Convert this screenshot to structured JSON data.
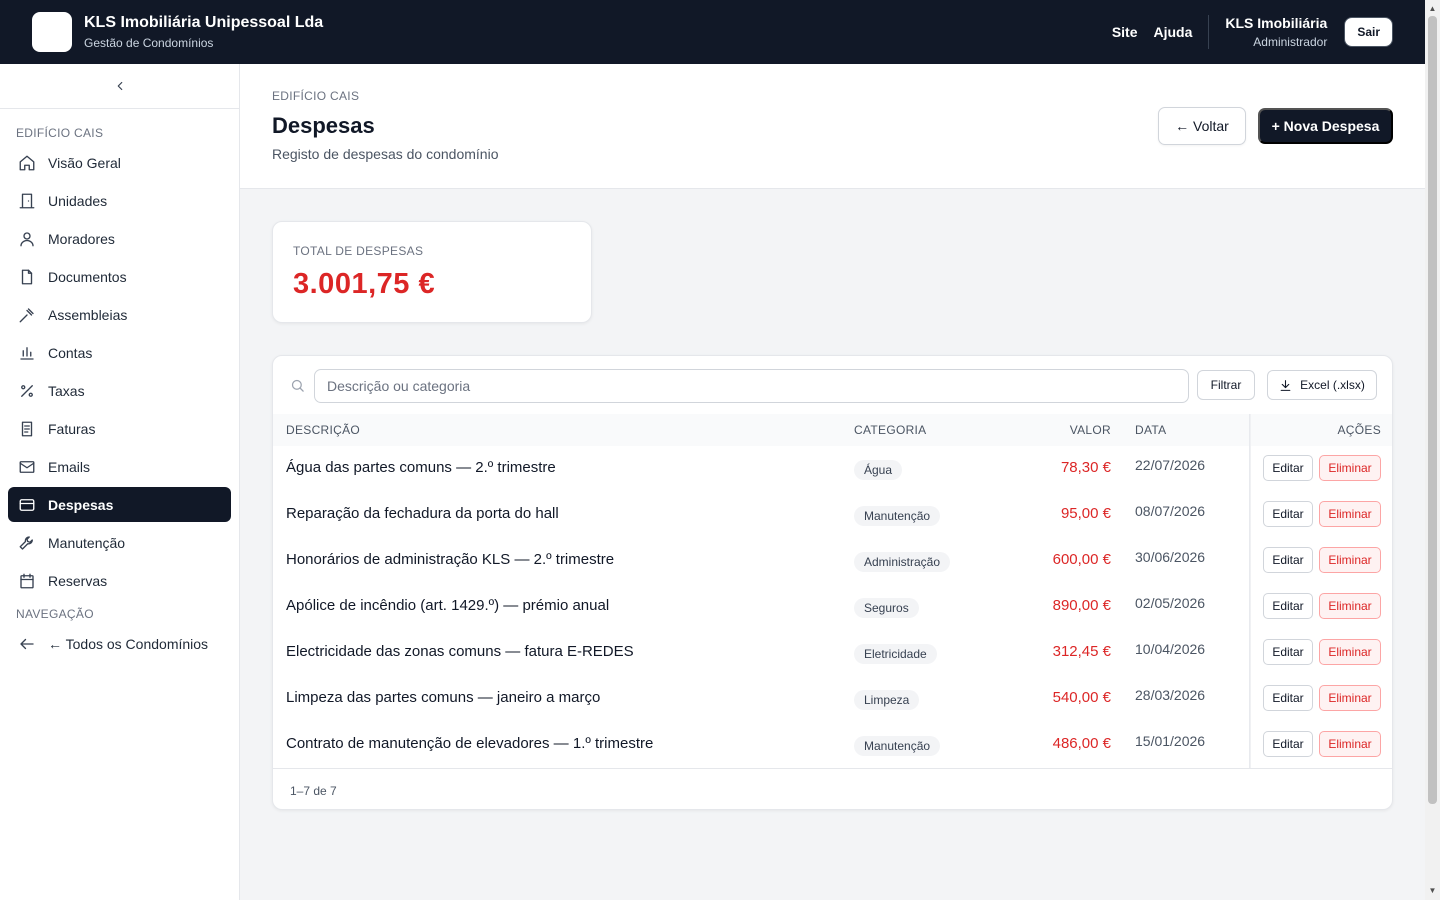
{
  "topbar": {
    "company": "KLS Imobiliária Unipessoal Lda",
    "subtitle": "Gestão de Condomínios",
    "links": [
      "Site",
      "Ajuda"
    ],
    "user_name": "KLS Imobiliária",
    "user_role": "Administrador",
    "logout_label": "Sair"
  },
  "sidebar": {
    "section_title": "EDIFÍCIO CAIS",
    "items": [
      {
        "label": "Visão Geral",
        "icon": "home-icon"
      },
      {
        "label": "Unidades",
        "icon": "door-icon"
      },
      {
        "label": "Moradores",
        "icon": "user-icon"
      },
      {
        "label": "Documentos",
        "icon": "file-icon"
      },
      {
        "label": "Assembleias",
        "icon": "gavel-icon"
      },
      {
        "label": "Contas",
        "icon": "bar-chart-icon"
      },
      {
        "label": "Taxas",
        "icon": "percent-icon"
      },
      {
        "label": "Faturas",
        "icon": "receipt-icon"
      },
      {
        "label": "Emails",
        "icon": "mail-icon"
      },
      {
        "label": "Despesas",
        "icon": "credit-card-icon",
        "active": true
      },
      {
        "label": "Manutenção",
        "icon": "wrench-icon"
      },
      {
        "label": "Reservas",
        "icon": "calendar-icon"
      }
    ],
    "nav_title": "NAVEGAÇÃO",
    "nav_item": "← Todos os Condomínios"
  },
  "header": {
    "breadcrumb": "EDIFÍCIO CAIS",
    "title": "Despesas",
    "subtitle": "Registo de despesas do condomínio",
    "back_label": "← Voltar",
    "new_label": "+ Nova Despesa"
  },
  "summary": {
    "label": "TOTAL DE DESPESAS",
    "value": "3.001,75 €"
  },
  "table": {
    "search_placeholder": "Descrição ou categoria",
    "filter_label": "Filtrar",
    "export_label": "Excel (.xlsx)",
    "columns": {
      "description": "DESCRIÇÃO",
      "category": "CATEGORIA",
      "value": "VALOR",
      "date": "DATA",
      "actions": "AÇÕES"
    },
    "rows": [
      {
        "description": "Água das partes comuns — 2.º trimestre",
        "category": "Água",
        "value": "78,30 €",
        "date": "22/07/2026"
      },
      {
        "description": "Reparação da fechadura da porta do hall",
        "category": "Manutenção",
        "value": "95,00 €",
        "date": "08/07/2026"
      },
      {
        "description": "Honorários de administração KLS — 2.º trimestre",
        "category": "Administração",
        "value": "600,00 €",
        "date": "30/06/2026"
      },
      {
        "description": "Apólice de incêndio (art. 1429.º) — prémio anual",
        "category": "Seguros",
        "value": "890,00 €",
        "date": "02/05/2026"
      },
      {
        "description": "Electricidade das zonas comuns — fatura E-REDES",
        "category": "Eletricidade",
        "value": "312,45 €",
        "date": "10/04/2026"
      },
      {
        "description": "Limpeza das partes comuns — janeiro a março",
        "category": "Limpeza",
        "value": "540,00 €",
        "date": "28/03/2026"
      },
      {
        "description": "Contrato de manutenção de elevadores — 1.º trimestre",
        "category": "Manutenção",
        "value": "486,00 €",
        "date": "15/01/2026"
      }
    ],
    "edit_label": "Editar",
    "delete_label": "Eliminar",
    "pagination": "1–7 de 7"
  },
  "colors": {
    "dark": "#111827",
    "danger": "#dc2626"
  }
}
